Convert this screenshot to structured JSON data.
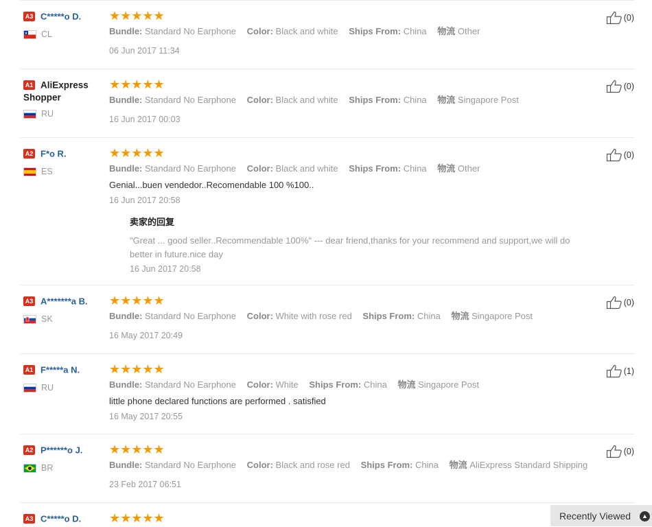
{
  "reviews": [
    {
      "badge": "A3",
      "name": "C*****o D.",
      "name_style": "link",
      "country": "CL",
      "stars": "★★★★★",
      "bundle_label": "Bundle:",
      "bundle": "Standard No Earphone",
      "color_label": "Color:",
      "color": "Black and white",
      "ships_label": "Ships From:",
      "ships": "China",
      "logistics_label": "物流",
      "logistics": "Other",
      "text": "",
      "date": "06 Jun 2017 11:34",
      "useful": "(0)"
    },
    {
      "badge": "A1",
      "name": "AliExpress Shopper",
      "name_style": "dark",
      "country": "RU",
      "stars": "★★★★★",
      "bundle_label": "Bundle:",
      "bundle": "Standard No Earphone",
      "color_label": "Color:",
      "color": "Black and white",
      "ships_label": "Ships From:",
      "ships": "China",
      "logistics_label": "物流",
      "logistics": "Singapore Post",
      "text": "",
      "date": "16 Jun 2017 00:03",
      "useful": "(0)"
    },
    {
      "badge": "A2",
      "name": "F*o R.",
      "name_style": "link",
      "country": "ES",
      "stars": "★★★★★",
      "bundle_label": "Bundle:",
      "bundle": "Standard No Earphone",
      "color_label": "Color:",
      "color": "Black and white",
      "ships_label": "Ships From:",
      "ships": "China",
      "logistics_label": "物流",
      "logistics": "Other",
      "text": "Genial...buen vendedor..Recomendable 100 %100..",
      "date": "16 Jun 2017 20:58",
      "useful": "(0)",
      "reply": {
        "title": "卖家的回复",
        "text": "\"Great ... good seller..Recommendable 100%\" --- dear friend,thanks for your recommend and support,we will do better in future.nice day",
        "date": "16 Jun 2017 20:58"
      }
    },
    {
      "badge": "A3",
      "name": "A*******a B.",
      "name_style": "link",
      "country": "SK",
      "stars": "★★★★★",
      "bundle_label": "Bundle:",
      "bundle": "Standard No Earphone",
      "color_label": "Color:",
      "color": "White with rose red",
      "ships_label": "Ships From:",
      "ships": "China",
      "logistics_label": "物流",
      "logistics": "Singapore Post",
      "text": "",
      "date": "16 May 2017 20:49",
      "useful": "(0)"
    },
    {
      "badge": "A1",
      "name": "F*****a N.",
      "name_style": "link",
      "country": "RU",
      "stars": "★★★★★",
      "bundle_label": "Bundle:",
      "bundle": "Standard No Earphone",
      "color_label": "Color:",
      "color": "White",
      "ships_label": "Ships From:",
      "ships": "China",
      "logistics_label": "物流",
      "logistics": "Singapore Post",
      "text": "little phone declared functions are performed . satisfied",
      "date": "16 May 2017 20:55",
      "useful": "(1)"
    },
    {
      "badge": "A2",
      "name": "P******o J.",
      "name_style": "link",
      "country": "BR",
      "stars": "★★★★★",
      "bundle_label": "Bundle:",
      "bundle": "Standard No Earphone",
      "color_label": "Color:",
      "color": "Black and rose red",
      "ships_label": "Ships From:",
      "ships": "China",
      "logistics_label": "物流",
      "logistics": "AliExpress Standard Shipping",
      "text": "",
      "date": "23 Feb 2017 06:51",
      "useful": "(0)"
    },
    {
      "badge": "A3",
      "name": "C*****o D.",
      "name_style": "link",
      "country": "",
      "stars": "★★★★★",
      "bundle_label": "",
      "bundle": "",
      "color_label": "",
      "color": "",
      "ships_label": "",
      "ships": "",
      "logistics_label": "",
      "logistics": "",
      "text": "",
      "date": "",
      "useful": ""
    }
  ],
  "recently_viewed": "Recently Viewed",
  "colors": {
    "link": "#2a5f9e",
    "star": "#f59b00",
    "badge": "#d7301c"
  }
}
